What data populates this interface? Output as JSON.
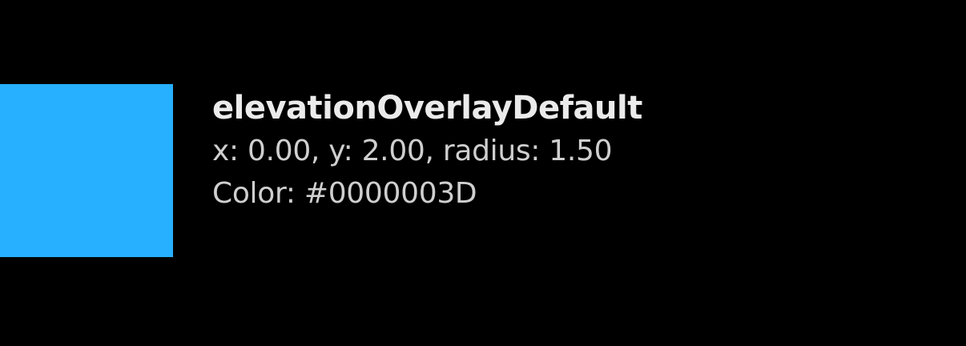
{
  "token": {
    "name": "elevationOverlayDefault",
    "offset_line": "x: 0.00, y: 2.00, radius: 1.50",
    "color_line": "Color: #0000003D",
    "swatch_color": "#26b0ff"
  }
}
